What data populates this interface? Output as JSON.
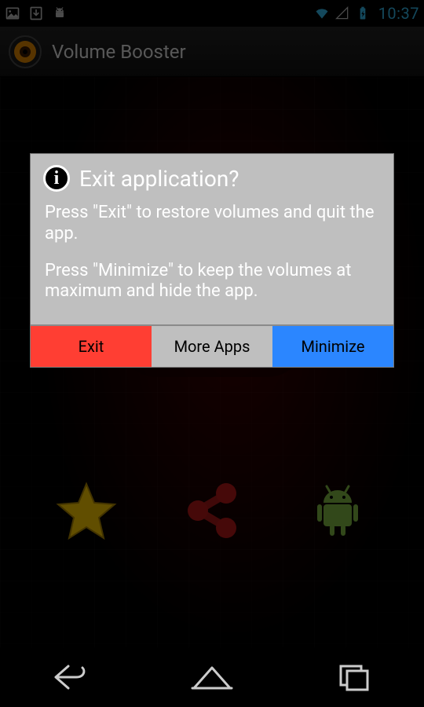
{
  "status_bar": {
    "time": "10:37",
    "left_icons": [
      "image-icon",
      "download-icon",
      "android-icon"
    ],
    "right_icons": [
      "wifi-icon",
      "cell-signal-icon",
      "battery-charging-icon"
    ]
  },
  "action_bar": {
    "title": "Volume Booster",
    "icon": "speaker-icon"
  },
  "content_icons": {
    "star": "star-icon",
    "share": "share-icon",
    "android": "android-mascot-icon"
  },
  "dialog": {
    "icon": "info-icon",
    "title": "Exit application?",
    "body_line1": "Press \"Exit\" to restore volumes and quit the app.",
    "body_line2": "Press \"Minimize\" to keep the volumes at maximum and hide the app.",
    "buttons": {
      "exit": "Exit",
      "more": "More Apps",
      "minimize": "Minimize"
    },
    "colors": {
      "exit": "#ff3e33",
      "more": "#bfbfbf",
      "minimize": "#2b86ff"
    }
  },
  "nav_bar": {
    "back": "back-button",
    "home": "home-button",
    "recents": "recents-button"
  }
}
